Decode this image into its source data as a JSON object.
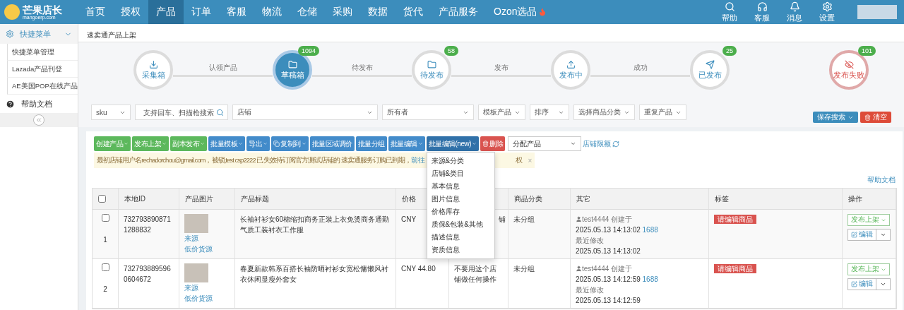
{
  "brand": {
    "name": "芒果店长",
    "domain": "mangoerp.com"
  },
  "nav": [
    {
      "label": "首页",
      "selected": false,
      "hot": false
    },
    {
      "label": "授权",
      "selected": false,
      "hot": false
    },
    {
      "label": "产品",
      "selected": true,
      "hot": false
    },
    {
      "label": "订单",
      "selected": false,
      "hot": false
    },
    {
      "label": "客服",
      "selected": false,
      "hot": false
    },
    {
      "label": "物流",
      "selected": false,
      "hot": false
    },
    {
      "label": "仓储",
      "selected": false,
      "hot": false
    },
    {
      "label": "采购",
      "selected": false,
      "hot": false
    },
    {
      "label": "数据",
      "selected": false,
      "hot": false
    },
    {
      "label": "货代",
      "selected": false,
      "hot": false
    },
    {
      "label": "产品服务",
      "selected": false,
      "hot": false
    },
    {
      "label": "Ozon选品",
      "selected": false,
      "hot": true
    }
  ],
  "nav_tools": [
    {
      "kind": "search",
      "label": "帮助"
    },
    {
      "kind": "service",
      "label": "客服"
    },
    {
      "kind": "bell",
      "label": "消息"
    },
    {
      "kind": "gear",
      "label": "设置"
    }
  ],
  "sidebar": {
    "section": {
      "label": "快捷菜单",
      "expanded": true,
      "children": [
        {
          "label": "快捷菜单管理"
        },
        {
          "label": "Lazada产品刊登"
        },
        {
          "label": "AE美国POP在线产品"
        }
      ]
    },
    "help": "帮助文档"
  },
  "breadcrumb": "速卖通产品上架",
  "pipeline": {
    "steps": [
      {
        "kind": "download",
        "label": "采集箱",
        "selected": false,
        "failed": false
      },
      {
        "kind": "folder",
        "label": "草稿箱",
        "count": "1094",
        "selected": true,
        "failed": false
      },
      {
        "kind": "folder",
        "label": "待发布",
        "count": "58",
        "selected": false,
        "failed": false
      },
      {
        "kind": "upload",
        "label": "发布中",
        "selected": false,
        "failed": false
      },
      {
        "kind": "send",
        "label": "已发布",
        "count": "25",
        "selected": false,
        "failed": false
      },
      {
        "kind": "eye",
        "label": "发布失败",
        "count": "101",
        "selected": false,
        "failed": true
      }
    ],
    "links": [
      "认领产品",
      "待发布",
      "发布",
      "成功"
    ]
  },
  "filters": [
    {
      "kind": "select",
      "value": "sku"
    },
    {
      "kind": "search",
      "placeholder": "支持回车、扫描枪搜索"
    },
    {
      "kind": "select",
      "value": "店铺"
    },
    {
      "kind": "select",
      "value": "所有者"
    },
    {
      "kind": "menu",
      "value": "模板产品"
    },
    {
      "kind": "select",
      "value": "排序"
    },
    {
      "kind": "menu",
      "value": "选择商品分类"
    },
    {
      "kind": "menu",
      "value": "重复产品"
    }
  ],
  "save_search": "保存搜索",
  "clear": "清空",
  "toolbar": [
    {
      "kind": "menu",
      "label": "创建产品",
      "color": "#5cb85c",
      "open": false
    },
    {
      "kind": "menu",
      "label": "发布上架",
      "color": "#5cb85c",
      "open": false
    },
    {
      "kind": "menu",
      "label": "副本发布",
      "color": "#5cb85c",
      "open": false
    },
    {
      "kind": "menu",
      "label": "批量模板",
      "color": "#428bca",
      "open": false
    },
    {
      "kind": "menu",
      "label": "导出",
      "color": "#428bca",
      "open": false
    },
    {
      "kind": "menu",
      "label": "复制到",
      "color": "#428bca",
      "open": false
    },
    {
      "kind": "action",
      "label": "批量区域调价",
      "color": "#428bca",
      "open": false
    },
    {
      "kind": "action",
      "label": "批量分组",
      "color": "#428bca",
      "open": false
    },
    {
      "kind": "menu",
      "label": "批量编辑",
      "color": "#428bca",
      "open": false
    },
    {
      "kind": "menu",
      "label": "批量编辑(new)",
      "color": "#3071a9",
      "open": true,
      "menu": [
        "来源&分类",
        "店铺&类目",
        "基本信息",
        "图片信息",
        "价格库存",
        "质保&包装&其他",
        "描述信息",
        "资质信息"
      ]
    },
    {
      "kind": "action",
      "label": "删除",
      "color": "#d9534f",
      "open": false
    }
  ],
  "assign": "分配产品",
  "store_limit": "店铺限额",
  "notice": {
    "text": "最初店铺用户名rechadorchou@gmail.com，被锁,test csp2222 已失效待订阅官方测试店铺的 速卖通服务订购已到期，",
    "link": "前往",
    "tail": "权",
    "close": "×"
  },
  "help_link": "帮助文档",
  "table": {
    "select_all": {
      "checked": false
    },
    "columns": [
      "本地ID",
      "产品图片",
      "产品标题",
      "价格",
      "",
      "商品分类",
      "其它",
      "标签",
      "操作"
    ],
    "rows": [
      {
        "index": "1",
        "checked": false,
        "id": "7327938908711288832",
        "source": "来源",
        "cheap": "低价货源",
        "title": "长袖衬衫女60棉缩扣商务正装上衣免烫商务通勤气质工装衬衣工作服",
        "price": "CNY",
        "column_6": "铺",
        "group": "未分组",
        "user": "test4444",
        "created_label": "创建于",
        "created": "2025.05.13 14:13:02",
        "origin": "1688",
        "modified_label": "最近修改",
        "modified": "2025.05.13 14:13:02",
        "tag": "请编辑商品",
        "publish": "发布上架",
        "edit": "编辑"
      },
      {
        "index": "2",
        "checked": false,
        "id": "7327938895960604672",
        "source": "来源",
        "cheap": "低价货源",
        "title": "春夏新款韩系百搭长袖防晒衬衫女宽松慵懒风衬衣休闲显瘦外套女",
        "price": "CNY 44.80",
        "column_6": "不要用这个店铺做任何操作",
        "group": "未分组",
        "user": "test4444",
        "created_label": "创建于",
        "created": "2025.05.13 14:12:59",
        "origin": "1688",
        "modified_label": "最近修改",
        "modified": "2025.05.13 14:12:59",
        "tag": "请编辑商品",
        "publish": "发布上架",
        "edit": "编辑"
      }
    ]
  }
}
